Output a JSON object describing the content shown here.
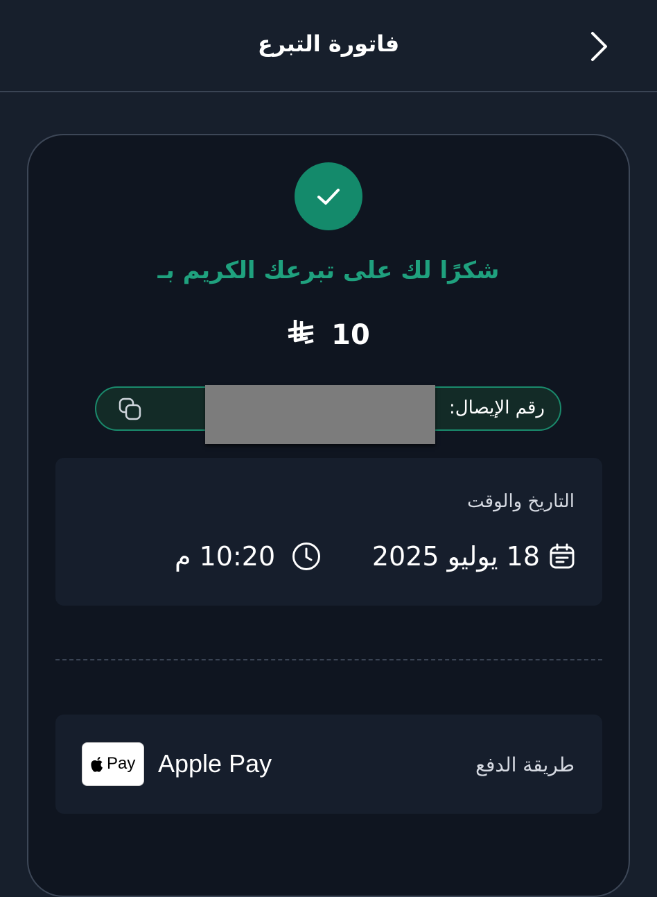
{
  "header": {
    "title": "فاتورة التبرع",
    "back_icon": "chevron-right-icon"
  },
  "success": {
    "icon": "check-icon",
    "color": "#148a6b",
    "message": "شكرًا لك على تبرعك الكريم بـ",
    "message_color": "#1fa17e"
  },
  "amount": {
    "value": "10",
    "currency_icon": "saudi-riyal-icon"
  },
  "receipt": {
    "label": "رقم الإيصال:",
    "value": "",
    "copy_icon": "copy-icon"
  },
  "datetime": {
    "label": "التاريخ والوقت",
    "date": "18 يوليو 2025",
    "time": "10:20 م",
    "calendar_icon": "calendar-icon",
    "clock_icon": "clock-icon"
  },
  "payment": {
    "label": "طريقة الدفع",
    "method": "Apple Pay",
    "badge_text": "Pay",
    "badge_icon": "apple-pay-icon"
  }
}
